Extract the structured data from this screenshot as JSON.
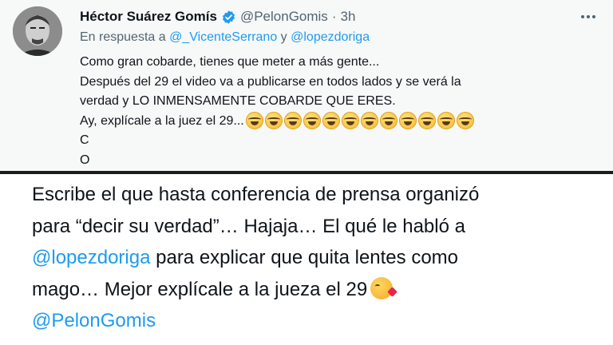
{
  "tweet": {
    "author_name": "Héctor Suárez Gomís",
    "author_handle": "@PelonGomis",
    "separator": "·",
    "time": "3h",
    "reply_prefix": "En respuesta a",
    "reply_mention_1": "@_VicenteSerrano",
    "reply_joiner": "y",
    "reply_mention_2": "@lopezdoriga",
    "lines": [
      "Como gran cobarde, tienes que meter a más gente...",
      "Después del 29 el video va a publicarse en todos lados y se verá la",
      "verdad y LO INMENSAMENTE COBARDE QUE ERES.",
      "Ay, explícale a la juez el 29...",
      "C",
      "O"
    ],
    "emoji_count": 12,
    "icons": [
      "verified-badge-icon",
      "more-options-icon",
      "avatar"
    ],
    "accent_color": "#1d9bf0"
  },
  "reply": {
    "line1": "Escribe el que hasta conferencia de prensa organizó",
    "line2": "para “decir su verdad”… Hajaja… El qué le habló a",
    "line3_mention": "@lopezdoriga",
    "line3_rest": " para explicar que quita lentes como",
    "line4": "mago… Mejor explícale a la jueza el 29",
    "line5_mention": "@PelonGomis",
    "icons": [
      "kiss-emoji-icon"
    ]
  }
}
